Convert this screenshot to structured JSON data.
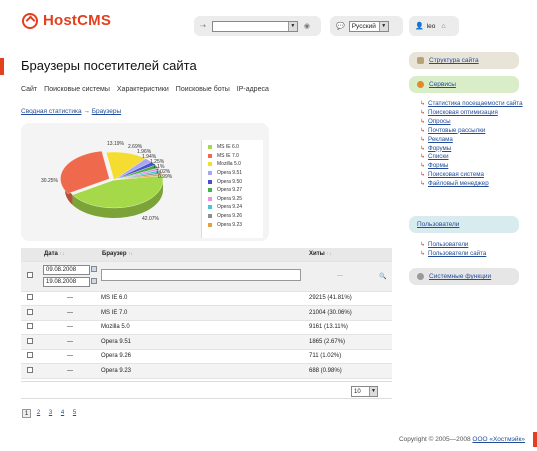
{
  "header": {
    "logo_text": "HostCMS",
    "search_value": "",
    "language": "Русский",
    "user": "leo"
  },
  "page": {
    "title": "Браузеры посетителей сайта",
    "tabs": [
      "Сайт",
      "Поисковые системы",
      "Характеристики",
      "Поисковые боты",
      "IP-адреса"
    ],
    "breadcrumb": {
      "parent": "Сводная статистика",
      "arrow": "→",
      "current": "Браузеры"
    }
  },
  "chart_data": {
    "type": "pie",
    "categories": [
      "MS IE 6.0",
      "MS IE 7.0",
      "Mozilla 5.0",
      "Opera 9.51",
      "Opera 9.50",
      "Opera 9.27",
      "Opera 9.25",
      "Opera 9.24",
      "Opera 9.26",
      "Opera 9.23"
    ],
    "values": [
      42.07,
      30.25,
      13.19,
      2.69,
      1.96,
      1.94,
      1.25,
      1.1,
      1.02,
      0.99
    ],
    "labels": [
      "42.07%",
      "30.25%",
      "13.19%",
      "2.69%",
      "1.96%",
      "1.94%",
      "1.25%",
      "1.1%",
      "1.02%",
      "0.99%"
    ],
    "colors": [
      "#a5d94a",
      "#ef6a4d",
      "#f4dc31",
      "#a9a5f2",
      "#4a4fd1",
      "#49b047",
      "#e990e3",
      "#44c6d4",
      "#8d8d8d",
      "#e6a23a"
    ],
    "legend_position": "right"
  },
  "table": {
    "headers": {
      "date": "Дата",
      "browser": "Браузер",
      "hits": "Хиты"
    },
    "sort_arrows": "↑↓",
    "filter": {
      "date_from": "09.08.2008",
      "date_to": "19.08.2008",
      "browser": "",
      "hits": "—"
    },
    "rows": [
      {
        "date": "—",
        "browser": "MS IE 6.0",
        "hits": "29215 (41.81%)"
      },
      {
        "date": "—",
        "browser": "MS IE 7.0",
        "hits": "21004 (30.06%)"
      },
      {
        "date": "—",
        "browser": "Mozilla 5.0",
        "hits": "9161 (13.11%)"
      },
      {
        "date": "—",
        "browser": "Opera 9.51",
        "hits": "1865 (2.67%)"
      },
      {
        "date": "—",
        "browser": "Opera 9.26",
        "hits": "711 (1.02%)"
      },
      {
        "date": "—",
        "browser": "Opera 9.23",
        "hits": "688 (0.98%)"
      }
    ],
    "page_size": "10"
  },
  "pager": {
    "current": "1",
    "pages": [
      "2",
      "3",
      "4",
      "5"
    ]
  },
  "footer": {
    "copyright": "Copyright © 2005—2008",
    "company": "ООО «Хостмэйк»"
  },
  "sidebar": {
    "structure": "Структура сайта",
    "services": "Сервисы",
    "services_items": [
      "Статистика посещаемости сайта",
      "Поисковая оптимизация",
      "Опросы",
      "Почтовые рассылки",
      "Реклама",
      "Форумы",
      "Списки",
      "Формы",
      "Поисковая система",
      "Файловый менеджер"
    ],
    "users": "Пользователи",
    "users_items": [
      "Пользователи",
      "Пользователи сайта"
    ],
    "system": "Системные функции"
  }
}
